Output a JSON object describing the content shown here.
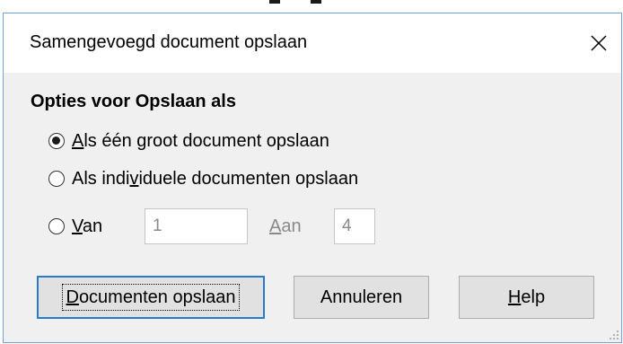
{
  "dialog": {
    "title": "Samengevoegd document opslaan",
    "close_icon": "close-icon"
  },
  "options": {
    "section_label": "Opties voor Opslaan als",
    "single": {
      "prefix": "A",
      "rest": "ls één groot document opslaan",
      "checked": true
    },
    "individual": {
      "prefix": "Als indi",
      "accel": "v",
      "rest": "iduele documenten opslaan",
      "checked": false
    },
    "range": {
      "from_accel": "V",
      "from_rest": "an",
      "from_value": "1",
      "to_accel": "A",
      "to_rest": "an",
      "to_value": "4",
      "checked": false
    }
  },
  "buttons": {
    "save": {
      "accel": "D",
      "rest": "ocumenten opslaan"
    },
    "cancel": "Annuleren",
    "help": {
      "accel": "H",
      "rest": "elp"
    }
  },
  "colors": {
    "accent": "#2b78d0",
    "window_border": "#6fa5d6",
    "dialog_bg": "#f0f0f0"
  }
}
